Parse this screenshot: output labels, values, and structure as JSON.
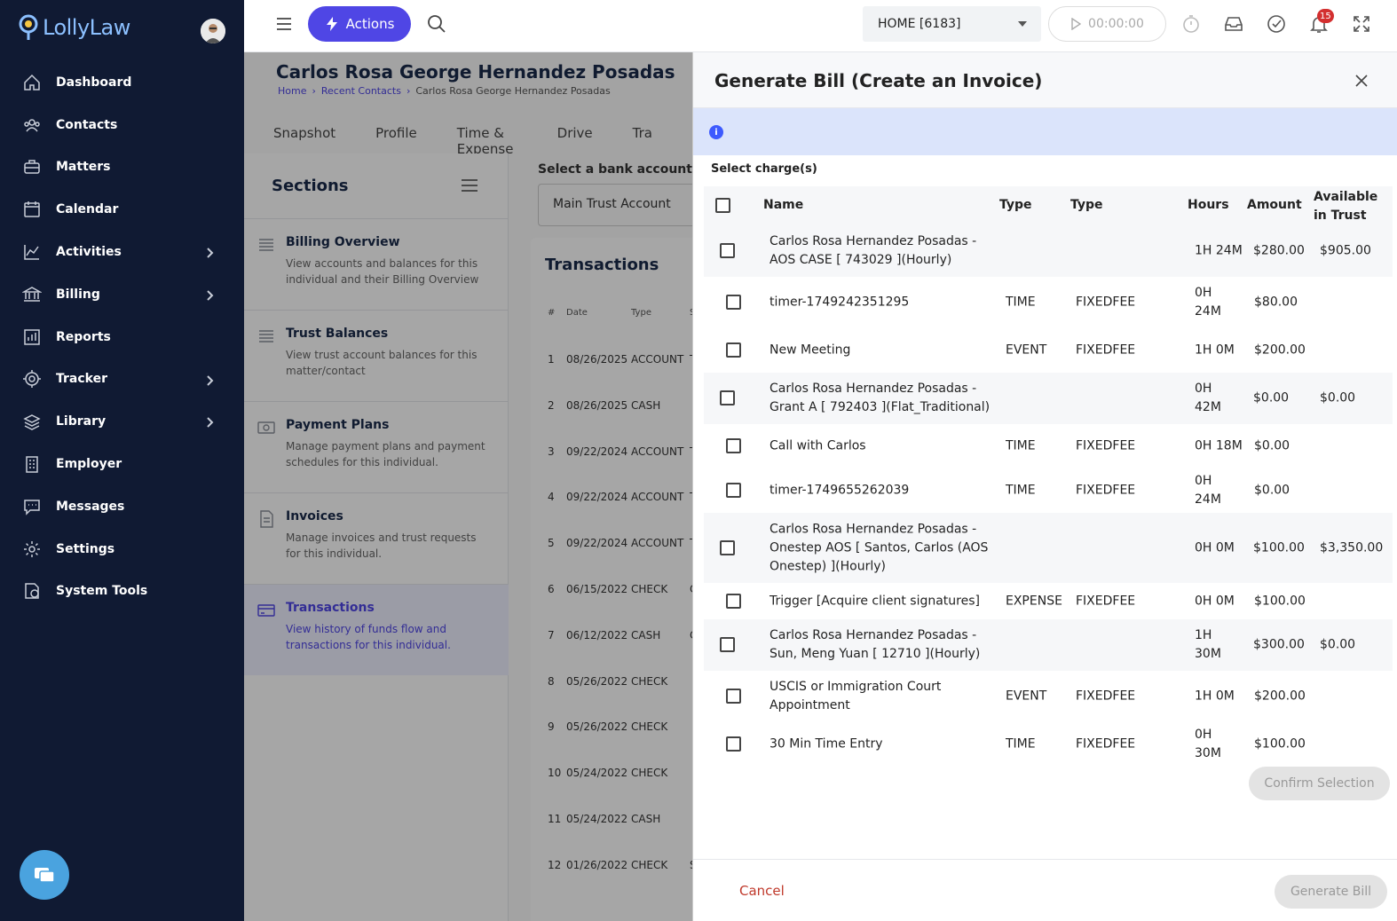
{
  "app": {
    "logo_text": "LollyLaw"
  },
  "sidebar": {
    "items": [
      {
        "label": "Dashboard",
        "icon": "home-icon",
        "chevron": false
      },
      {
        "label": "Contacts",
        "icon": "users-icon",
        "chevron": false
      },
      {
        "label": "Matters",
        "icon": "briefcase-icon",
        "chevron": false
      },
      {
        "label": "Calendar",
        "icon": "calendar-icon",
        "chevron": false
      },
      {
        "label": "Activities",
        "icon": "activity-chart-icon",
        "chevron": true
      },
      {
        "label": "Billing",
        "icon": "bank-icon",
        "chevron": true
      },
      {
        "label": "Reports",
        "icon": "bar-chart-icon",
        "chevron": false
      },
      {
        "label": "Tracker",
        "icon": "target-icon",
        "chevron": true
      },
      {
        "label": "Library",
        "icon": "library-icon",
        "chevron": true
      },
      {
        "label": "Employer",
        "icon": "building-icon",
        "chevron": false
      },
      {
        "label": "Messages",
        "icon": "message-icon",
        "chevron": false
      },
      {
        "label": "Settings",
        "icon": "gear-icon",
        "chevron": false
      },
      {
        "label": "System Tools",
        "icon": "system-tools-icon",
        "chevron": false
      }
    ]
  },
  "topbar": {
    "actions_label": "Actions",
    "home_select": "HOME [6183]",
    "timer": "00:00:00",
    "notifications_count": "15"
  },
  "background": {
    "title": "Carlos Rosa George Hernandez Posadas",
    "breadcrumbs": [
      "Home",
      "Recent Contacts",
      "Carlos Rosa George Hernandez Posadas"
    ],
    "tabs": [
      "Snapshot",
      "Profile",
      "Time & Expense",
      "Drive",
      "Tra"
    ],
    "sections_title": "Sections",
    "sections": [
      {
        "name": "Billing Overview",
        "desc": "View accounts and balances for this individual and their Billing Overview"
      },
      {
        "name": "Trust Balances",
        "desc": "View trust account balances for this matter/contact"
      },
      {
        "name": "Payment Plans",
        "desc": "Manage payment plans and payment schedules for this individual."
      },
      {
        "name": "Invoices",
        "desc": "Manage invoices and trust requests for this individual."
      },
      {
        "name": "Transactions",
        "desc": "View history of funds flow and transactions for this individual."
      }
    ],
    "bank_label": "Select a bank account to v",
    "bank_value": "Main Trust Account",
    "transactions_title": "Transactions",
    "trans_headers": [
      "#",
      "Date",
      "Type",
      "S"
    ],
    "trans_rows": [
      {
        "n": "1",
        "date": "08/26/2025",
        "type": "ACCOUNT",
        "s": "T"
      },
      {
        "n": "2",
        "date": "08/26/2025",
        "type": "CASH",
        "s": ""
      },
      {
        "n": "3",
        "date": "09/22/2024",
        "type": "ACCOUNT",
        "s": "T"
      },
      {
        "n": "4",
        "date": "09/22/2024",
        "type": "ACCOUNT",
        "s": "T"
      },
      {
        "n": "5",
        "date": "09/22/2024",
        "type": "ACCOUNT",
        "s": "T"
      },
      {
        "n": "6",
        "date": "06/15/2022",
        "type": "CHECK",
        "s": "C"
      },
      {
        "n": "7",
        "date": "06/12/2022",
        "type": "CASH",
        "s": "C"
      },
      {
        "n": "8",
        "date": "05/26/2022",
        "type": "CHECK",
        "s": ""
      },
      {
        "n": "9",
        "date": "05/26/2022",
        "type": "CHECK",
        "s": ""
      },
      {
        "n": "10",
        "date": "05/24/2022",
        "type": "CHECK",
        "s": ""
      },
      {
        "n": "11",
        "date": "05/24/2022",
        "type": "CASH",
        "s": ""
      },
      {
        "n": "12",
        "date": "01/26/2022",
        "type": "CHECK",
        "s": "S"
      }
    ]
  },
  "panel": {
    "title": "Generate Bill (Create an Invoice)",
    "select_label": "Select charge(s)",
    "headers": {
      "name": "Name",
      "type1": "Type",
      "type2": "Type",
      "hours": "Hours",
      "amount": "Amount",
      "trust": "Available in Trust"
    },
    "rows": [
      {
        "name": "Carlos Rosa Hernandez Posadas - AOS CASE [ 743029 ](Hourly)",
        "type1": "",
        "type2": "",
        "hours": "1H 24M",
        "amount": "$280.00",
        "trust": "$905.00",
        "parent": true
      },
      {
        "name": "timer-1749242351295",
        "type1": "TIME",
        "type2": "FIXEDFEE",
        "hours": "0H 24M",
        "amount": "$80.00",
        "trust": "",
        "parent": false
      },
      {
        "name": "New Meeting",
        "type1": "EVENT",
        "type2": "FIXEDFEE",
        "hours": "1H 0M",
        "amount": "$200.00",
        "trust": "",
        "parent": false
      },
      {
        "name": "Carlos Rosa Hernandez Posadas - Grant A [ 792403 ](Flat_Traditional)",
        "type1": "",
        "type2": "",
        "hours": "0H 42M",
        "amount": "$0.00",
        "trust": "$0.00",
        "parent": true
      },
      {
        "name": "Call with Carlos",
        "type1": "TIME",
        "type2": "FIXEDFEE",
        "hours": "0H 18M",
        "amount": "$0.00",
        "trust": "",
        "parent": false
      },
      {
        "name": "timer-1749655262039",
        "type1": "TIME",
        "type2": "FIXEDFEE",
        "hours": "0H 24M",
        "amount": "$0.00",
        "trust": "",
        "parent": false
      },
      {
        "name": "Carlos Rosa Hernandez Posadas - Onestep AOS [ Santos, Carlos (AOS Onestep) ](Hourly)",
        "type1": "",
        "type2": "",
        "hours": "0H 0M",
        "amount": "$100.00",
        "trust": "$3,350.00",
        "parent": true
      },
      {
        "name": "Trigger [Acquire client signatures]",
        "type1": "EXPENSE",
        "type2": "FIXEDFEE",
        "hours": "0H 0M",
        "amount": "$100.00",
        "trust": "",
        "parent": false
      },
      {
        "name": "Carlos Rosa Hernandez Posadas - Sun, Meng Yuan [ 12710 ](Hourly)",
        "type1": "",
        "type2": "",
        "hours": "1H 30M",
        "amount": "$300.00",
        "trust": "$0.00",
        "parent": true
      },
      {
        "name": "USCIS or Immigration Court Appointment",
        "type1": "EVENT",
        "type2": "FIXEDFEE",
        "hours": "1H 0M",
        "amount": "$200.00",
        "trust": "",
        "parent": false
      },
      {
        "name": "30 Min Time Entry",
        "type1": "TIME",
        "type2": "FIXEDFEE",
        "hours": "0H 30M",
        "amount": "$100.00",
        "trust": "",
        "parent": false
      }
    ],
    "confirm_label": "Confirm Selection",
    "cancel_label": "Cancel",
    "generate_label": "Generate Bill"
  }
}
